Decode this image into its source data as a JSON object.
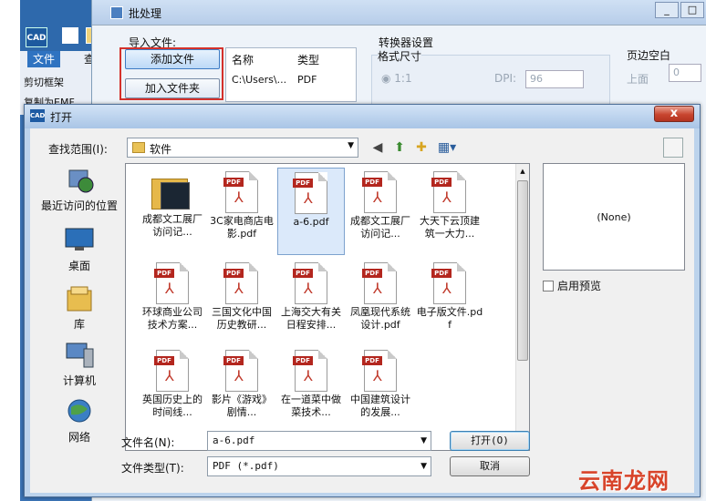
{
  "cad_app": {
    "logo_text": "CAD",
    "tabs": [
      "文件",
      "查看"
    ],
    "ribbon_items": [
      "剪切框架",
      "复制为EMF"
    ]
  },
  "batch_dialog": {
    "title": "批处理",
    "import_label": "导入文件:",
    "add_file_button": "添加文件",
    "add_folder_button": "加入文件夹",
    "file_list_headers": [
      "名称",
      "类型"
    ],
    "file_list_row": {
      "name": "C:\\Users\\...",
      "type": "PDF"
    },
    "converter_settings_label": "转换器设置",
    "format_size_label": "格式尺寸",
    "ratio_label": "1:1",
    "dpi_label": "DPI:",
    "dpi_value": "96",
    "margin_label": "页边空白",
    "top_label": "上面",
    "top_value": "0"
  },
  "open_dialog": {
    "title": "打开",
    "title_icon": "CAD",
    "close_glyph": "x",
    "look_in_label": "查找范围(I):",
    "look_in_value": "软件",
    "places": [
      {
        "label": "最近访问的位置",
        "icon": "recent-places-icon"
      },
      {
        "label": "桌面",
        "icon": "desktop-icon"
      },
      {
        "label": "库",
        "icon": "libraries-icon"
      },
      {
        "label": "计算机",
        "icon": "computer-icon"
      },
      {
        "label": "网络",
        "icon": "network-icon"
      }
    ],
    "files": [
      {
        "name": "成都文工展厂访问记...",
        "kind": "folder"
      },
      {
        "name": "3C家电商店电影.pdf",
        "kind": "pdf"
      },
      {
        "name": "a-6.pdf",
        "kind": "pdf",
        "selected": true
      },
      {
        "name": "成都文工展厂访问记...",
        "kind": "pdf"
      },
      {
        "name": "大天下云顶建筑一大力...",
        "kind": "pdf"
      },
      {
        "name": "环球商业公司技术方案...",
        "kind": "pdf"
      },
      {
        "name": "三国文化中国历史教研...",
        "kind": "pdf"
      },
      {
        "name": "上海交大有关日程安排...",
        "kind": "pdf"
      },
      {
        "name": "凤凰现代系统设计.pdf",
        "kind": "pdf"
      },
      {
        "name": "电子版文件.pdf",
        "kind": "pdf"
      },
      {
        "name": "英国历史上的时间线...",
        "kind": "pdf"
      },
      {
        "name": "影片《游戏》剧情...",
        "kind": "pdf"
      },
      {
        "name": "在一道菜中做菜技术...",
        "kind": "pdf"
      },
      {
        "name": "中国建筑设计的发展...",
        "kind": "pdf"
      }
    ],
    "pdf_tag": "PDF",
    "preview_text": "(None)",
    "enable_preview_label": "启用预览",
    "filename_label": "文件名(N):",
    "filename_value": "a-6.pdf",
    "filetype_label": "文件类型(T):",
    "filetype_value": "PDF (*.pdf)",
    "open_button": "打开(O)",
    "cancel_button": "取消"
  },
  "watermark": "云南龙网",
  "colors": {
    "highlight_box": "#d4312b",
    "pdf_tag": "#b3261e",
    "title_bar": "#a9c5e6"
  }
}
